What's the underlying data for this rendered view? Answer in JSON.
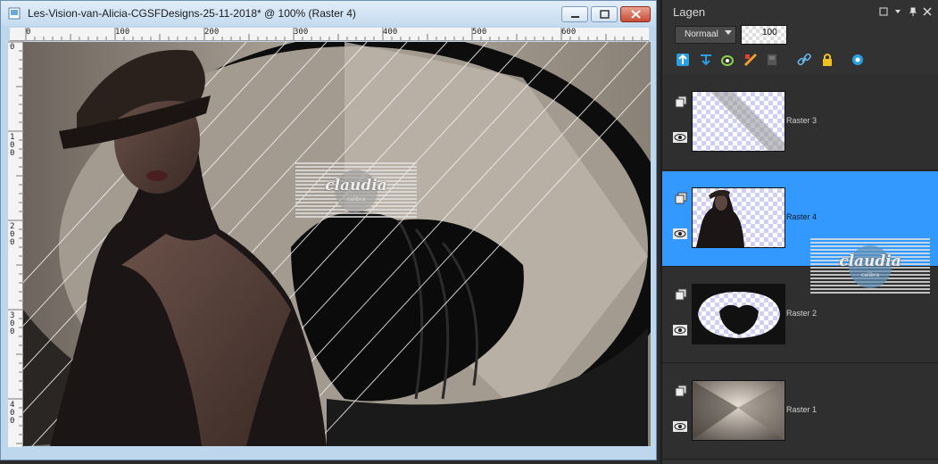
{
  "window": {
    "title": "Les-Vision-van-Alicia-CGSFDesigns-25-11-2018* @ 100% (Raster 4)"
  },
  "ruler": {
    "top_labels": [
      "0",
      "100",
      "200",
      "300",
      "400",
      "500",
      "600"
    ],
    "left_labels": [
      "0",
      "1\n0\n0",
      "2\n0\n0",
      "3\n0\n0",
      "4\n0\n0"
    ]
  },
  "watermark": {
    "text": "claudia",
    "subtext": "calibra"
  },
  "layers_panel": {
    "title": "Lagen",
    "blend_mode": "Normaal",
    "opacity": "100",
    "layers": [
      {
        "name": "Raster 3",
        "selected": false
      },
      {
        "name": "Raster 4",
        "selected": true
      },
      {
        "name": "Raster 2",
        "selected": false
      },
      {
        "name": "Raster 1",
        "selected": false
      }
    ]
  },
  "colors": {
    "selection": "#3399ff",
    "panel_bg": "#323232",
    "window_frame": "#bfd7ec"
  }
}
